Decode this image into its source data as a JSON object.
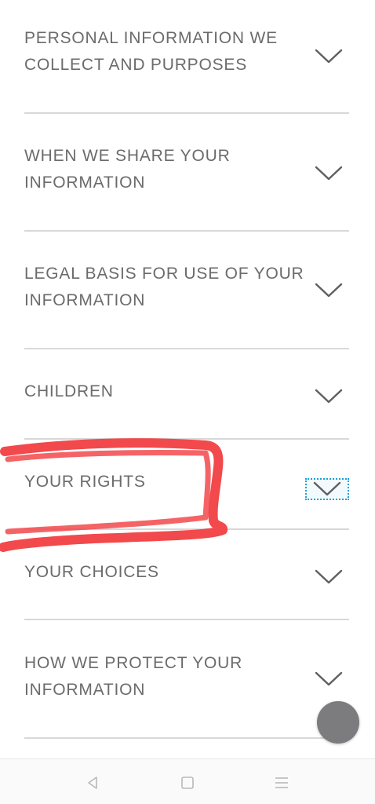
{
  "sections": [
    {
      "title": "PERSONAL INFORMATION WE\nCOLLECT AND PURPOSES",
      "name": "section-personal-information"
    },
    {
      "title": "WHEN WE SHARE YOUR\nINFORMATION",
      "name": "section-when-we-share"
    },
    {
      "title": "LEGAL BASIS FOR USE OF YOUR\nINFORMATION",
      "name": "section-legal-basis"
    },
    {
      "title": "CHILDREN",
      "name": "section-children"
    },
    {
      "title": "YOUR RIGHTS",
      "name": "section-your-rights"
    },
    {
      "title": "YOUR CHOICES",
      "name": "section-your-choices"
    },
    {
      "title": "HOW WE PROTECT YOUR\nINFORMATION",
      "name": "section-how-we-protect"
    }
  ],
  "colors": {
    "text": "#6b6b6b",
    "divider": "#d8d8d8",
    "annotation": "#f2494c",
    "focus_outline": "#1aa3d8",
    "fab": "#7c7c7e"
  },
  "icons": {
    "expand": "chevron-down-icon",
    "nav_back": "back-triangle-icon",
    "nav_home": "home-square-icon",
    "nav_menu": "menu-lines-icon"
  }
}
